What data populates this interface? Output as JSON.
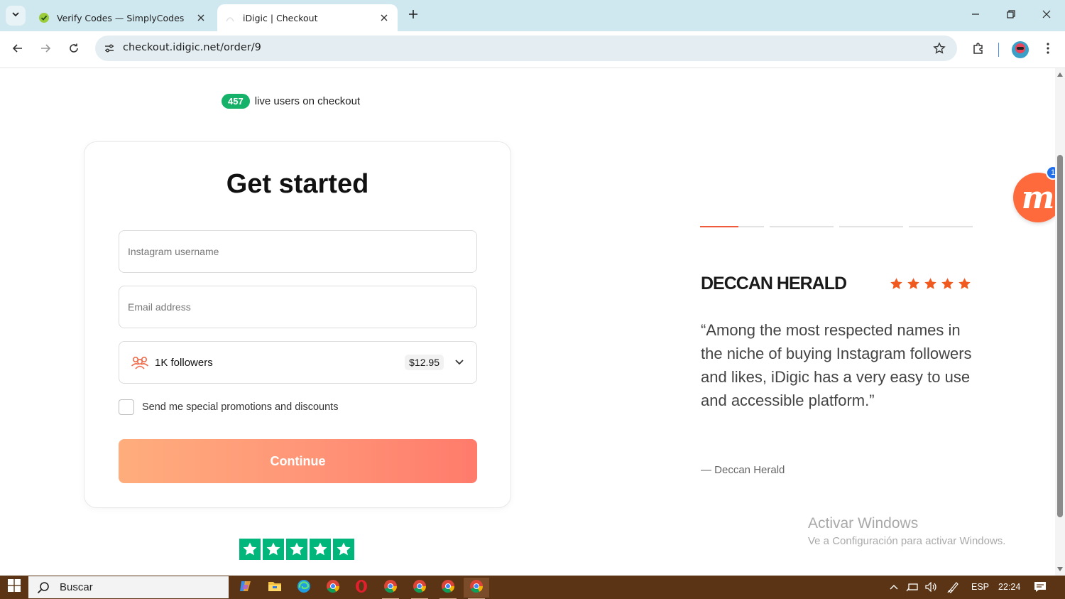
{
  "browser": {
    "tabs": [
      {
        "title": "Verify Codes — SimplyCodes",
        "active": false
      },
      {
        "title": "iDigic | Checkout",
        "active": true
      }
    ],
    "url": "checkout.idigic.net/order/9"
  },
  "page": {
    "live_count": "457",
    "live_text": "live users on checkout",
    "form": {
      "heading": "Get started",
      "username_placeholder": "Instagram username",
      "email_placeholder": "Email address",
      "package_label": "1K followers",
      "package_price": "$12.95",
      "promo_label": "Send me special promotions and discounts",
      "continue_label": "Continue"
    },
    "trustpilot_stars": 5,
    "testimonial": {
      "slide_index": 1,
      "slide_count": 4,
      "slide_progress": 0.6,
      "publication": "DECCAN HERALD",
      "rating": 5,
      "quote": "“Among the most respected names in the niche of buying Instagram followers and likes, iDigic has a very easy to use and accessible platform.”",
      "byline": "— Deccan Herald"
    },
    "chat_badge": "1",
    "watermark": {
      "title": "Activar Windows",
      "subtitle": "Ve a Configuración para activar Windows."
    }
  },
  "taskbar": {
    "search_label": "Buscar",
    "language": "ESP",
    "time": "22:24"
  },
  "colors": {
    "accent_orange": "#ff7b6b",
    "live_badge": "#17b26a",
    "star": "#f05a1e",
    "trustpilot": "#00b67a",
    "tabbar": "#cfe7ef",
    "taskbar": "#5b3415"
  }
}
